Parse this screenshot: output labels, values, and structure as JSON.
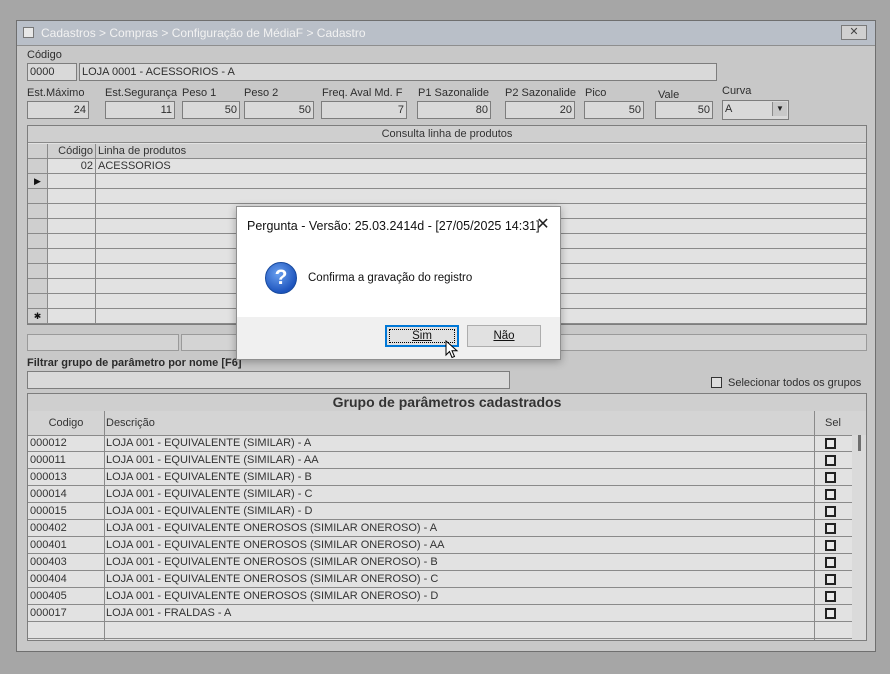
{
  "window": {
    "title": "Cadastros > Compras > Configuração de MédiaF > Cadastro",
    "close_glyph": "✕"
  },
  "form": {
    "codigo_label": "Código",
    "codigo_value": "0000",
    "descricao_value": "LOJA 0001 - ACESSORIOS - A",
    "fields": [
      {
        "label": "Est.Máximo",
        "value": "24"
      },
      {
        "label": "Est.Segurança",
        "value": "11"
      },
      {
        "label": "Peso 1",
        "value": "50"
      },
      {
        "label": "Peso 2",
        "value": "50"
      },
      {
        "label": "Freq. Aval Md. F",
        "value": "7"
      },
      {
        "label": "P1 Sazonalide",
        "value": "80"
      },
      {
        "label": "P2 Sazonalide",
        "value": "20"
      },
      {
        "label": "Pico",
        "value": "50"
      },
      {
        "label": "Vale",
        "value": "50"
      }
    ],
    "curva_label": "Curva",
    "curva_value": "A"
  },
  "product_grid": {
    "caption": "Consulta linha de produtos",
    "columns": [
      "Código",
      "Linha de produtos"
    ],
    "rows": [
      {
        "codigo": "02",
        "linha": "ACESSORIOS"
      }
    ],
    "current_marker": "▶",
    "new_marker": "✱"
  },
  "filter": {
    "label": "Filtrar grupo de parâmetro por nome [F6]",
    "value": "",
    "select_all_label": "Selecionar todos os grupos"
  },
  "groups_grid": {
    "caption": "Grupo de parâmetros cadastrados",
    "columns": [
      "Codigo",
      "Descrição",
      "Sel"
    ],
    "rows": [
      {
        "codigo": "000012",
        "descricao": "LOJA 001 - EQUIVALENTE (SIMILAR) - A"
      },
      {
        "codigo": "000011",
        "descricao": "LOJA 001 - EQUIVALENTE (SIMILAR) - AA"
      },
      {
        "codigo": "000013",
        "descricao": "LOJA 001 - EQUIVALENTE (SIMILAR) - B"
      },
      {
        "codigo": "000014",
        "descricao": "LOJA 001 - EQUIVALENTE (SIMILAR) - C"
      },
      {
        "codigo": "000015",
        "descricao": "LOJA 001 - EQUIVALENTE (SIMILAR) - D"
      },
      {
        "codigo": "000402",
        "descricao": "LOJA 001 - EQUIVALENTE ONEROSOS (SIMILAR ONEROSO) - A"
      },
      {
        "codigo": "000401",
        "descricao": "LOJA 001 - EQUIVALENTE ONEROSOS (SIMILAR ONEROSO) - AA"
      },
      {
        "codigo": "000403",
        "descricao": "LOJA 001 - EQUIVALENTE ONEROSOS (SIMILAR ONEROSO) - B"
      },
      {
        "codigo": "000404",
        "descricao": "LOJA 001 - EQUIVALENTE ONEROSOS (SIMILAR ONEROSO) - C"
      },
      {
        "codigo": "000405",
        "descricao": "LOJA 001 - EQUIVALENTE ONEROSOS (SIMILAR ONEROSO) - D"
      },
      {
        "codigo": "000017",
        "descricao": "LOJA 001 - FRALDAS - A"
      }
    ]
  },
  "dialog": {
    "title": "Pergunta - Versão: 25.03.2414d - [27/05/2025 14:31]",
    "close_glyph": "✕",
    "icon": "question-icon",
    "icon_glyph": "?",
    "message": "Confirma a gravação do registro",
    "yes_label": "Sim",
    "no_label": "Não"
  }
}
